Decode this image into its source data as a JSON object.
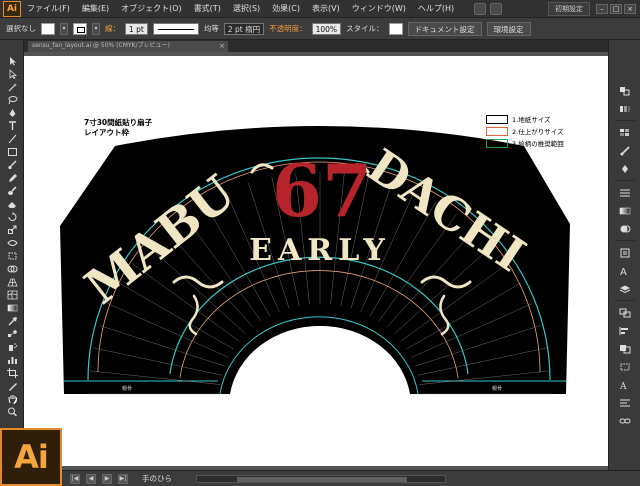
{
  "menubar": {
    "logo": "Ai",
    "items": [
      "ファイル(F)",
      "編集(E)",
      "オブジェクト(O)",
      "書式(T)",
      "選択(S)",
      "効果(C)",
      "表示(V)",
      "ウィンドウ(W)",
      "ヘルプ(H)"
    ],
    "workspace_label": "初期設定",
    "window_controls": [
      "–",
      "□",
      "×"
    ]
  },
  "controlbar": {
    "selection_status": "選択なし",
    "stroke_label": "線：",
    "stroke_weight": "1 pt",
    "profile_label": "均等",
    "brush_label": "2 pt 楕円",
    "opacity_label": "不透明度：",
    "opacity_value": "100%",
    "style_label": "スタイル：",
    "doc_settings_button": "ドキュメント設定",
    "preferences_button": "環境設定"
  },
  "tab": {
    "title": "sensu_fan_layout.ai @ 50% (CMYK/プレビュー)",
    "close": "×"
  },
  "artboard": {
    "caption_line1": "7寸30間紙貼り扇子",
    "caption_line2": "レイアウト枠",
    "legend": [
      {
        "label": "1.地紙サイズ",
        "color": "#000000"
      },
      {
        "label": "2.仕上がりサイズ",
        "color": "#e8603c"
      },
      {
        "label": "3.絵柄の推奨範囲",
        "color": "#1aa84a"
      }
    ],
    "artwork_text": {
      "word_left": "MABU",
      "word_right": "DACHI",
      "word_center": "EARLY",
      "number": "67"
    },
    "rib_label": "親骨",
    "colors": {
      "background": "#000000",
      "cream": "#f1e6c3",
      "red": "#b8242b",
      "cyan": "#36c6c6",
      "guide": "#e9a27a"
    }
  },
  "statusbar": {
    "nav": [
      "|◀",
      "◀",
      "▶",
      "▶|"
    ],
    "tool_name": "手のひら"
  },
  "badge": {
    "label": "Ai"
  }
}
